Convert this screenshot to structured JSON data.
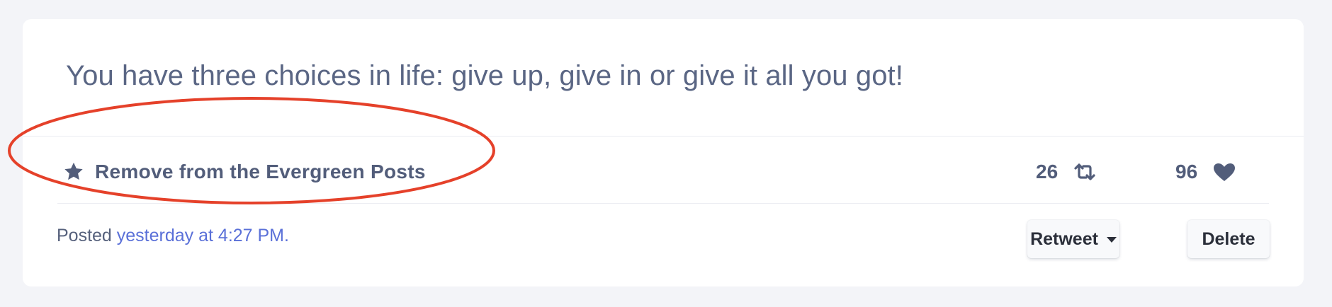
{
  "post": {
    "text": "You have three choices in life: give up, give in or give it all you got!"
  },
  "evergreen": {
    "label": "Remove from the Evergreen Posts",
    "icon": "star-icon"
  },
  "stats": {
    "retweets": "26",
    "retweet_icon": "retweet-icon",
    "likes": "96",
    "like_icon": "heart-icon"
  },
  "meta": {
    "posted_prefix": "Posted ",
    "posted_time": "yesterday at 4:27 PM."
  },
  "actions": {
    "retweet_label": "Retweet",
    "delete_label": "Delete"
  },
  "colors": {
    "page_bg": "#f3f4f8",
    "card_bg": "#ffffff",
    "text": "#525d7a",
    "link": "#5a70d8",
    "annotation": "#e5412a"
  }
}
